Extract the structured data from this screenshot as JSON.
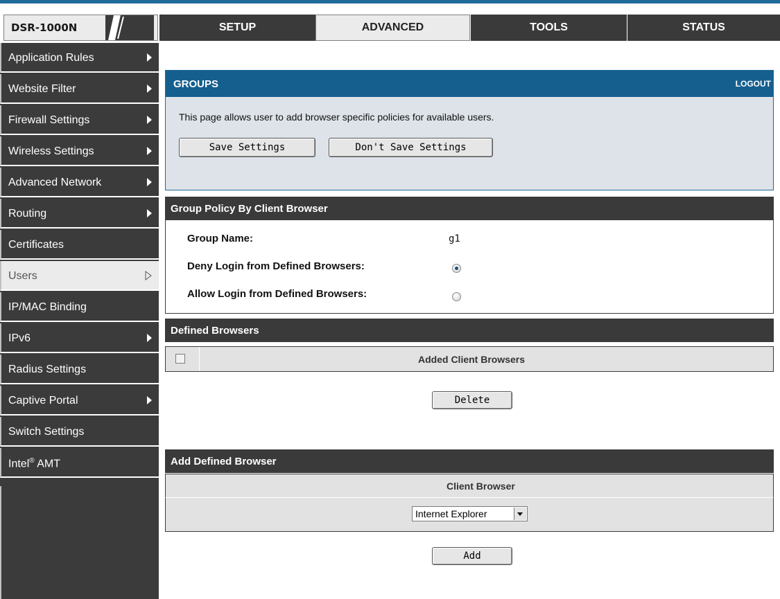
{
  "brand": {
    "model": "DSR-1000N"
  },
  "tabs": [
    {
      "label": "SETUP",
      "active": false
    },
    {
      "label": "ADVANCED",
      "active": true
    },
    {
      "label": "TOOLS",
      "active": false
    },
    {
      "label": "STATUS",
      "active": false
    }
  ],
  "sidebar": {
    "items": [
      {
        "label": "Application Rules",
        "has_submenu": true
      },
      {
        "label": "Website Filter",
        "has_submenu": true
      },
      {
        "label": "Firewall Settings",
        "has_submenu": true
      },
      {
        "label": "Wireless Settings",
        "has_submenu": true
      },
      {
        "label": "Advanced Network",
        "has_submenu": true
      },
      {
        "label": "Routing",
        "has_submenu": true
      },
      {
        "label": "Certificates",
        "has_submenu": false
      },
      {
        "label": "Users",
        "has_submenu": true,
        "active": true
      },
      {
        "label": "IP/MAC Binding",
        "has_submenu": false
      },
      {
        "label": "IPv6",
        "has_submenu": true
      },
      {
        "label": "Radius Settings",
        "has_submenu": false
      },
      {
        "label": "Captive Portal",
        "has_submenu": true
      },
      {
        "label": "Switch Settings",
        "has_submenu": false
      },
      {
        "label_prefix": "Intel",
        "label_sup": "®",
        "label_suffix": " AMT",
        "has_submenu": false
      }
    ]
  },
  "groups": {
    "title": "GROUPS",
    "logout": "LOGOUT",
    "description": "This page allows user to add browser specific policies for available users.",
    "save_label": "Save Settings",
    "dont_save_label": "Don't Save Settings"
  },
  "policy": {
    "title": "Group Policy By Client Browser",
    "group_name_label": "Group Name:",
    "group_name_value": "g1",
    "deny_label": "Deny Login from Defined Browsers:",
    "allow_label": "Allow Login from Defined Browsers:",
    "selected": "deny"
  },
  "defined_browsers": {
    "title": "Defined Browsers",
    "column_header": "Added Client Browsers",
    "delete_label": "Delete"
  },
  "add_browser": {
    "title": "Add Defined Browser",
    "column_header": "Client Browser",
    "selected_browser": "Internet Explorer",
    "add_label": "Add"
  },
  "colors": {
    "accent_blue": "#155f8e",
    "dark_bar": "#3a3a3a",
    "panel_bg": "#dde3e8"
  }
}
